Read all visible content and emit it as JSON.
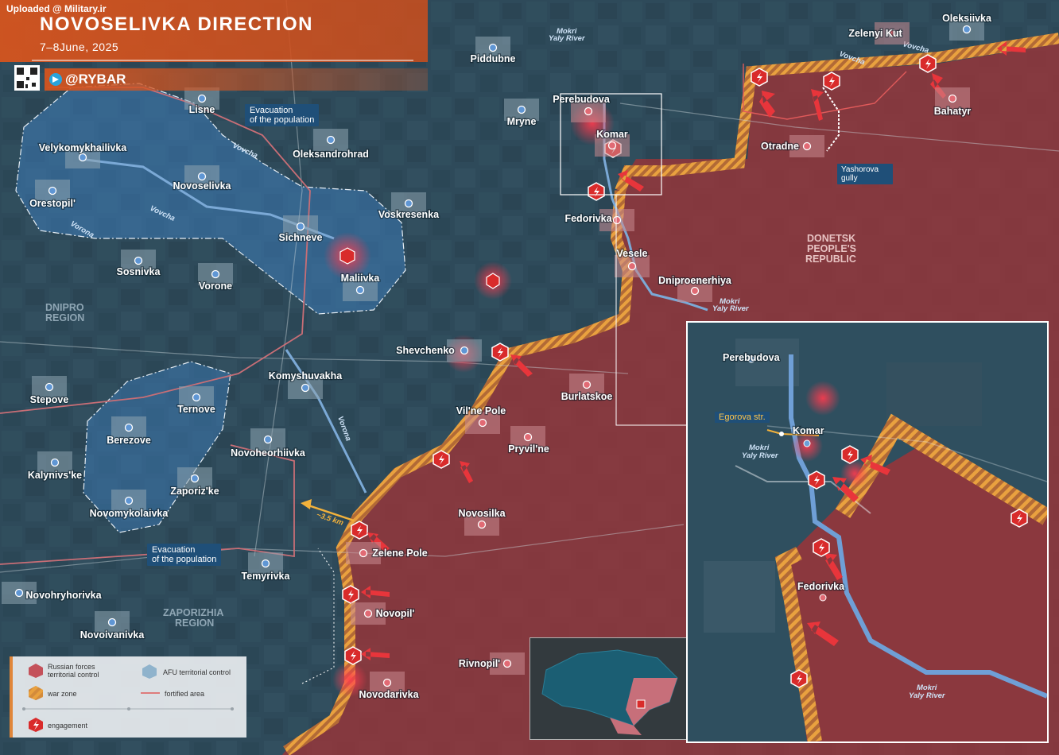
{
  "header": {
    "uploaded": "Uploaded @ Military.ir",
    "title": "NOVOSELIVKA DIRECTION",
    "subtitle": "7–8June, 2025",
    "brand": "@RYBAR",
    "qr_icon": "qr-code-icon",
    "messenger_icon": "telegram-icon",
    "accent_color": "#d5541e"
  },
  "colors": {
    "russian_control": "#9b3438",
    "afu_control": "#3d80c0",
    "war_zone": "#e3953c",
    "fortified": "#e05a5a",
    "engagement": "#d92b2b"
  },
  "settlements": [
    {
      "name": "Piddubne"
    },
    {
      "name": "Lisne"
    },
    {
      "name": "Velykomykhailivka"
    },
    {
      "name": "Oleksandrohrad"
    },
    {
      "name": "Novoselivka"
    },
    {
      "name": "Orestopil'"
    },
    {
      "name": "Voskresenka"
    },
    {
      "name": "Sichneve"
    },
    {
      "name": "Maliivka"
    },
    {
      "name": "Sosnivka"
    },
    {
      "name": "Vorone"
    },
    {
      "name": "Mryne"
    },
    {
      "name": "Perebudova"
    },
    {
      "name": "Komar"
    },
    {
      "name": "Fedorivka"
    },
    {
      "name": "Vesele"
    },
    {
      "name": "Dniproenerhiya"
    },
    {
      "name": "Otradne"
    },
    {
      "name": "Zelenyi Kut"
    },
    {
      "name": "Oleksiivka"
    },
    {
      "name": "Bahatyr"
    },
    {
      "name": "Shevchenko"
    },
    {
      "name": "Komyshuvakha"
    },
    {
      "name": "Burlatskoe"
    },
    {
      "name": "Vil'ne Pole"
    },
    {
      "name": "Pryvil'ne"
    },
    {
      "name": "Stepove"
    },
    {
      "name": "Ternove"
    },
    {
      "name": "Berezove"
    },
    {
      "name": "Novoheorhiivka"
    },
    {
      "name": "Kalynivs'ke"
    },
    {
      "name": "Zaporiz'ke"
    },
    {
      "name": "Novomykolaivka"
    },
    {
      "name": "Novosilka"
    },
    {
      "name": "Zelene Pole"
    },
    {
      "name": "Temyrivka"
    },
    {
      "name": "Novohryhorivka"
    },
    {
      "name": "Novopil'"
    },
    {
      "name": "Novoivanivka"
    },
    {
      "name": "Rivnopil'"
    },
    {
      "name": "Novodarivka"
    }
  ],
  "regions": {
    "dnipro": [
      "DNIPRO",
      "REGION"
    ],
    "zaporizhia": [
      "ZAPORIZHIA",
      "REGION"
    ],
    "donetsk": [
      "DONETSK",
      "PEOPLE'S",
      "REPUBLIC"
    ]
  },
  "rivers": {
    "mokri_yaly_top": [
      "Mokri",
      "Yaly River"
    ],
    "vovcha_1": "Vovcha",
    "vovcha_2": "Vovcha",
    "vovcha_3": "Vovcha",
    "vovcha_4": "Vovcha",
    "vorona_1": "Vorona",
    "vorona_2": "Vorona",
    "mokri_yaly_mid": [
      "Mokri",
      "Yaly River"
    ]
  },
  "callouts": {
    "evac_top": [
      "Evacuation",
      "of the population"
    ],
    "evac_bottom": [
      "Evacuation",
      "of the population"
    ],
    "yashorova": [
      "Yashorova",
      "gully"
    ],
    "distance": "~3.5 km"
  },
  "legend": {
    "russian": [
      "Russian forces",
      "territorial control"
    ],
    "afu": "AFU territorial control",
    "war_zone": "war zone",
    "fortified": "fortified area",
    "engagement": "engagement"
  },
  "inset": {
    "perebudova": "Perebudova",
    "komar": "Komar",
    "egorova": "Egorova str.",
    "mokri_yaly_1": [
      "Mokri",
      "Yaly River"
    ],
    "fedorivka": "Fedorivka",
    "mokri_yaly_2": [
      "Mokri",
      "Yaly River"
    ]
  }
}
